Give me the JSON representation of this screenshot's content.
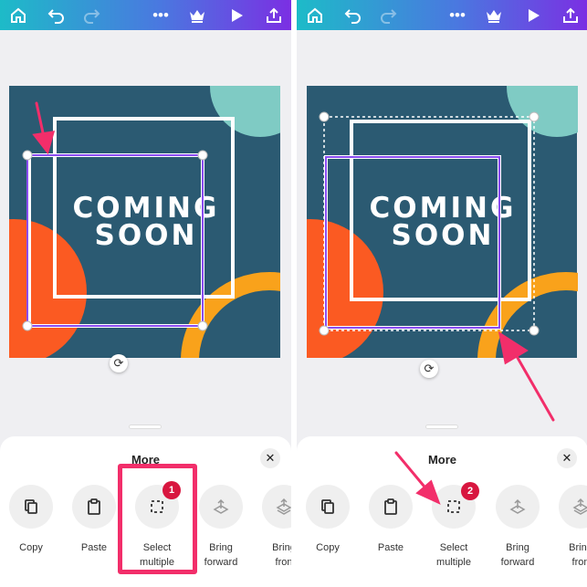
{
  "toolbar": {
    "icons": [
      "home-icon",
      "undo-icon",
      "redo-icon",
      "more-icon",
      "crown-icon",
      "play-icon",
      "share-icon"
    ],
    "more_glyph": "•••"
  },
  "design": {
    "line1": "COMING",
    "line2": "SOON",
    "colors": {
      "background": "#2b5a72",
      "teal": "#7fcbc4",
      "orange": "#fb5a22",
      "yellow": "#f9a21b",
      "selection": "#8a4cf0"
    }
  },
  "sheet": {
    "title": "More",
    "close": "✕",
    "actions": [
      {
        "label1": "Copy",
        "label2": "",
        "icon": "copy-icon"
      },
      {
        "label1": "Paste",
        "label2": "",
        "icon": "paste-icon"
      },
      {
        "label1": "Select",
        "label2": "multiple",
        "icon": "select-multiple-icon"
      },
      {
        "label1": "Bring",
        "label2": "forward",
        "icon": "bring-forward-icon"
      },
      {
        "label1": "Bring",
        "label2": "fron",
        "icon": "bring-front-icon"
      }
    ]
  },
  "annotations": {
    "step1": "1",
    "step2": "2",
    "highlight_color": "#f22e6a"
  }
}
